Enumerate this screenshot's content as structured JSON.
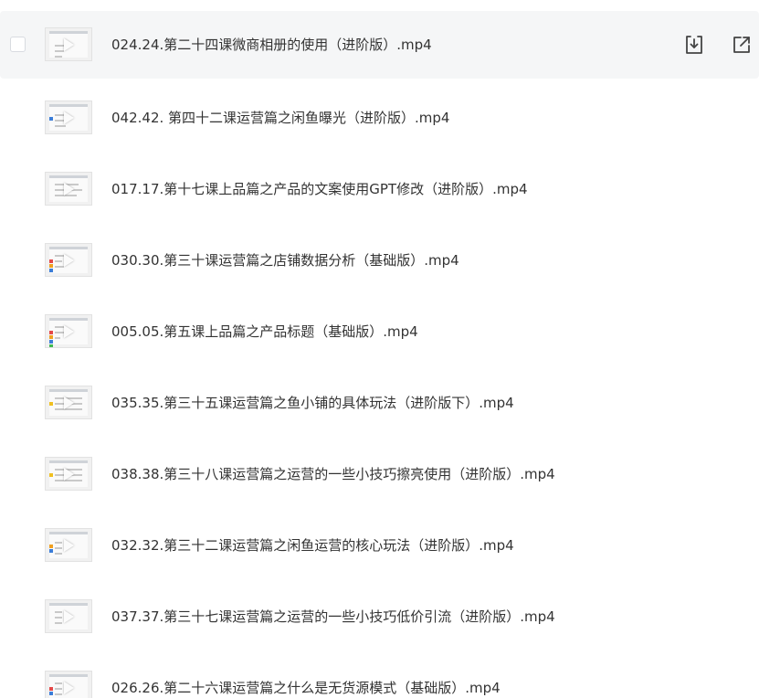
{
  "files": [
    {
      "name": "024.24.第二十四课微商相册的使用（进阶版）.mp4",
      "thumb_icon": "video-thumbnail",
      "hovered": true
    },
    {
      "name": "042.42. 第四十二课运营篇之闲鱼曝光（进阶版）.mp4",
      "thumb_icon": "video-thumbnail"
    },
    {
      "name": "017.17.第十七课上品篇之产品的文案使用GPT修改（进阶版）.mp4",
      "thumb_icon": "video-thumbnail"
    },
    {
      "name": "030.30.第三十课运营篇之店铺数据分析（基础版）.mp4",
      "thumb_icon": "video-thumbnail"
    },
    {
      "name": "005.05.第五课上品篇之产品标题（基础版）.mp4",
      "thumb_icon": "video-thumbnail"
    },
    {
      "name": "035.35.第三十五课运营篇之鱼小铺的具体玩法（进阶版下）.mp4",
      "thumb_icon": "video-thumbnail"
    },
    {
      "name": "038.38.第三十八课运营篇之运营的一些小技巧擦亮使用（进阶版）.mp4",
      "thumb_icon": "video-thumbnail"
    },
    {
      "name": "032.32.第三十二课运营篇之闲鱼运营的核心玩法（进阶版）.mp4",
      "thumb_icon": "video-thumbnail"
    },
    {
      "name": "037.37.第三十七课运营篇之运营的一些小技巧低价引流（进阶版）.mp4",
      "thumb_icon": "video-thumbnail"
    },
    {
      "name": "026.26.第二十六课运营篇之什么是无货源模式（基础版）.mp4",
      "thumb_icon": "video-thumbnail"
    }
  ],
  "actions": {
    "download_icon": "download-icon",
    "share_icon": "share-icon"
  },
  "colors": {
    "hover_bg": "#f5f6f7",
    "text": "#333333",
    "icon": "#444444"
  }
}
